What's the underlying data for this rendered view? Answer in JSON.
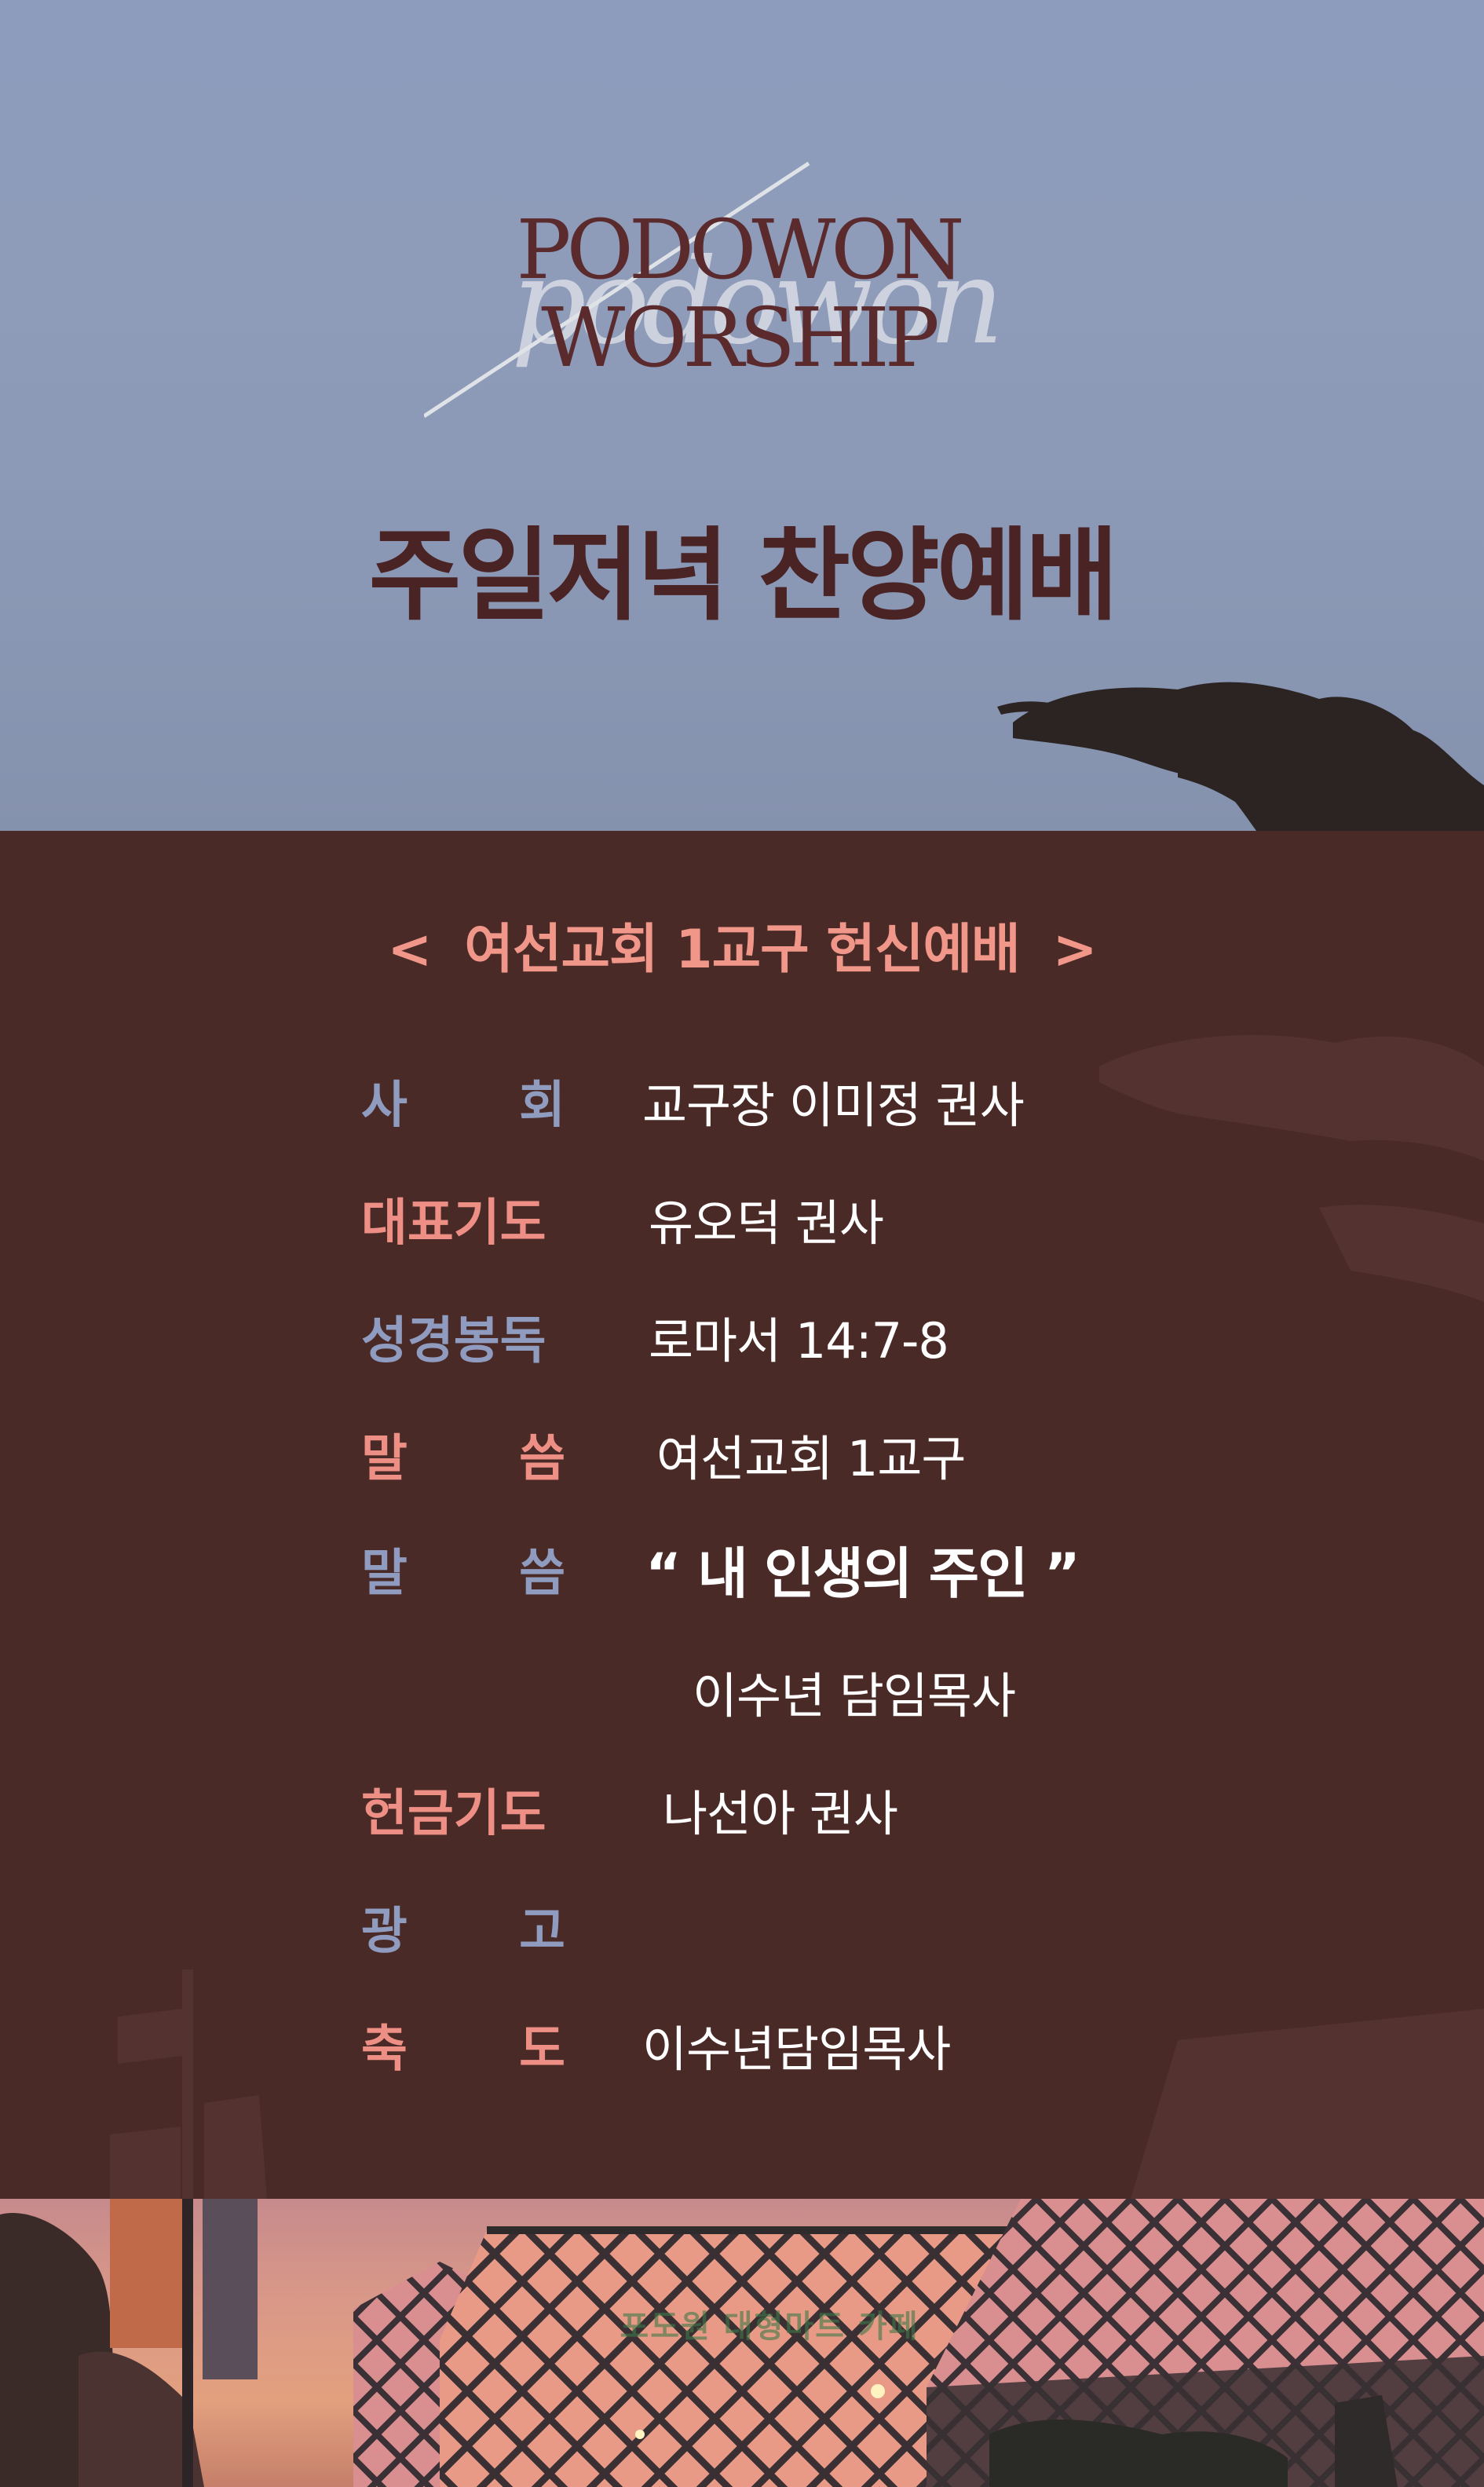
{
  "header": {
    "logo_line1": "PODOWON",
    "logo_line2": "WORSHIP",
    "logo_script": "podowon",
    "title": "주일저녁 찬양예배"
  },
  "program": {
    "service_title": "여선교회 1교구 헌신예배",
    "bracket_left": "<",
    "bracket_right": ">",
    "rows": [
      {
        "label": [
          "사",
          "회"
        ],
        "value": "교구장 이미정 권사"
      },
      {
        "label": [
          "대표기도"
        ],
        "value": "유오덕 권사"
      },
      {
        "label": [
          "성경봉독"
        ],
        "value": "로마서 14:7-8"
      },
      {
        "label": [
          "말",
          "씀"
        ],
        "value": "여선교회 1교구"
      },
      {
        "label": [
          "말",
          "씀"
        ],
        "value": "“ 내 인생의 주인 ”"
      },
      {
        "label": [],
        "value": "이수년 담임목사"
      },
      {
        "label": [
          "헌금기도"
        ],
        "value": "나선아 권사"
      },
      {
        "label": [
          "광",
          "고"
        ],
        "value": ""
      },
      {
        "label": [
          "축",
          "도"
        ],
        "value": "이수년담임목사"
      }
    ]
  },
  "photo": {
    "sign_text": "포도원 대형마트 카페"
  },
  "colors": {
    "sky": "#8d9cbc",
    "brown": "#4a2a26",
    "title": "#4a2324",
    "logo": "#5b2a2c",
    "pink": "#ee8f86",
    "blue": "#8f9cc0",
    "white": "#ffffff"
  }
}
